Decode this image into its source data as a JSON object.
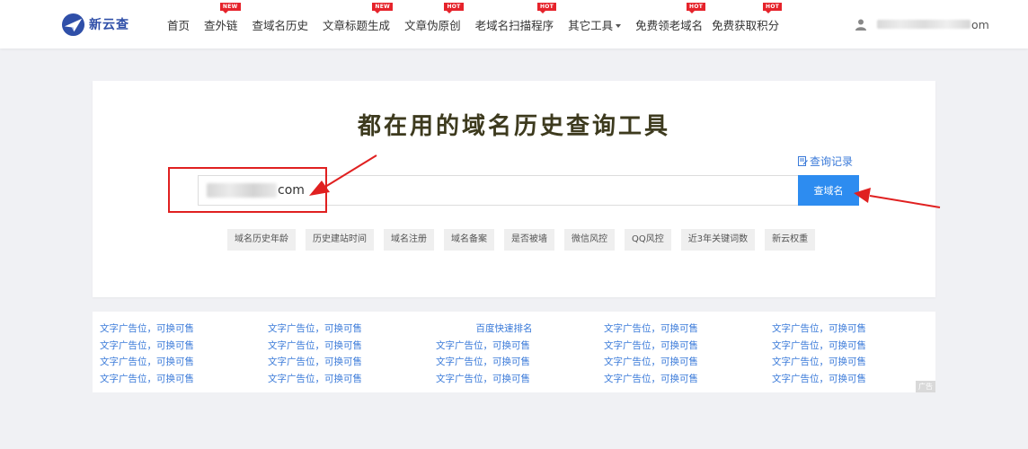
{
  "header": {
    "logo_text": "新云查",
    "nav": [
      {
        "label": "首页",
        "badge": ""
      },
      {
        "label": "查外链",
        "badge": "NEW"
      },
      {
        "label": "查域名历史",
        "badge": ""
      },
      {
        "label": "文章标题生成",
        "badge": "NEW"
      },
      {
        "label": "文章伪原创",
        "badge": "HOT"
      },
      {
        "label": "老域名扫描程序",
        "badge": "HOT"
      },
      {
        "label": "其它工具",
        "badge": ""
      },
      {
        "label": "免费领老域名",
        "badge": "HOT"
      },
      {
        "label": "免费获取积分",
        "badge": "HOT"
      }
    ],
    "user_suffix": "om"
  },
  "main": {
    "title": "都在用的域名历史查询工具",
    "history_link": "查询记录",
    "search_value": "com",
    "search_button": "查域名",
    "tags": [
      "域名历史年龄",
      "历史建站时间",
      "域名注册",
      "域名备案",
      "是否被墙",
      "微信风控",
      "QQ风控",
      "近3年关键词数",
      "新云权重"
    ]
  },
  "ads": {
    "rows": [
      [
        "文字广告位，可换可售",
        "文字广告位，可换可售",
        "百度快速排名",
        "文字广告位，可换可售",
        "文字广告位，可换可售"
      ],
      [
        "文字广告位，可换可售",
        "文字广告位，可换可售",
        "文字广告位，可换可售",
        "文字广告位，可换可售",
        "文字广告位，可换可售"
      ],
      [
        "文字广告位，可换可售",
        "文字广告位，可换可售",
        "文字广告位，可换可售",
        "文字广告位，可换可售",
        "文字广告位，可换可售"
      ],
      [
        "文字广告位，可换可售",
        "文字广告位，可换可售",
        "文字广告位，可换可售",
        "文字广告位，可换可售",
        "文字广告位，可换可售"
      ]
    ],
    "corner_label": "广告"
  },
  "colors": {
    "accent": "#2d8cf0",
    "link": "#3a7ad9",
    "badge": "#e6232b",
    "annotation": "#e02020"
  }
}
